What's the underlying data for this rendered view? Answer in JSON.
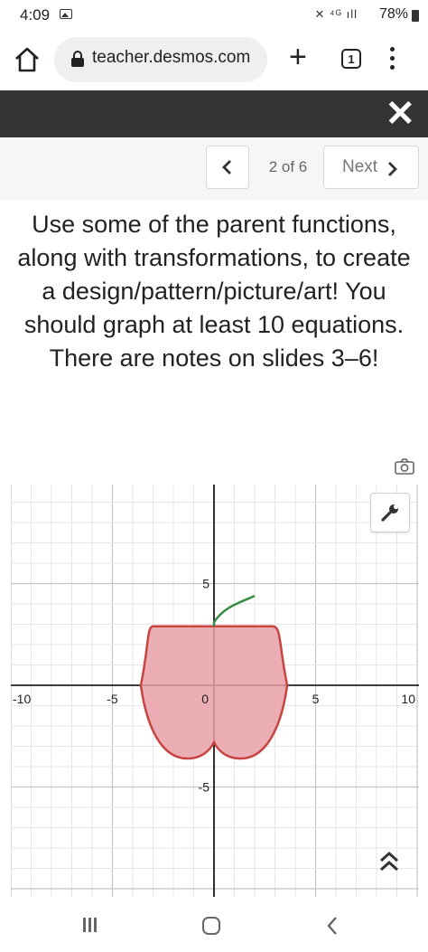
{
  "status_bar": {
    "time": "4:09",
    "system_indicators": "✕ ⁴ᴳ ıll",
    "battery": "78%"
  },
  "browser": {
    "url": "teacher.desmos.com",
    "tab_count": "1"
  },
  "navigation": {
    "page_indicator": "2 of 6",
    "next_label": "Next"
  },
  "prompt_text": "Use some of the parent functions, along with transformations, to create a design/pattern/picture/art! You should graph at least 10 equations. There are notes on slides 3–6!",
  "graph": {
    "x_tick_labels": [
      "-10",
      "-5",
      "0",
      "5",
      "10"
    ],
    "y_tick_labels": [
      "5",
      "-5"
    ],
    "x_range": [
      -10,
      10
    ],
    "y_range": [
      -10,
      10
    ],
    "shape_colors": {
      "fill": "#e8a0a8",
      "stroke": "#c74440",
      "stem": "#388c46"
    }
  },
  "colors": {
    "dark_bar": "#333436",
    "axis": "#000000",
    "grid_minor": "#e6e6e6",
    "grid_major": "#c4c4c4"
  }
}
